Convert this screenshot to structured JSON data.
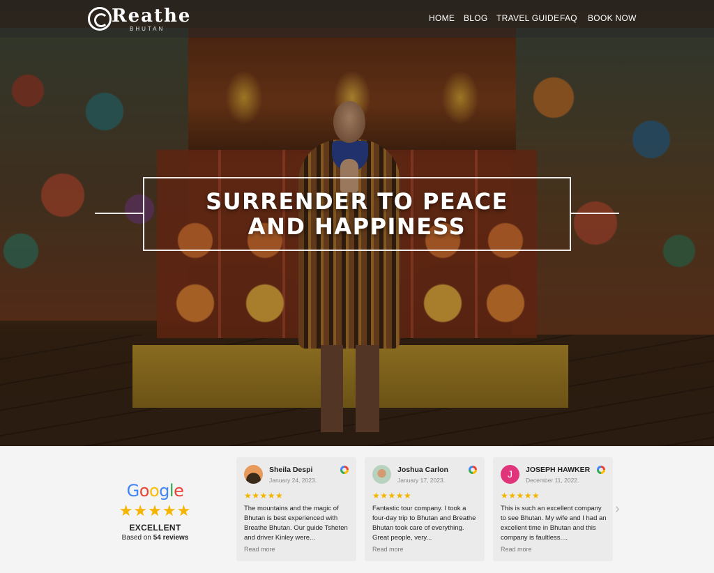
{
  "nav": {
    "logo": {
      "name": "Reathe",
      "sub": "BHUTAN"
    },
    "links": [
      "HOME",
      "BLOG",
      "TRAVEL GUIDE",
      "FAQ",
      "BOOK NOW"
    ]
  },
  "hero": {
    "headline": "SURRENDER TO PEACE AND HAPPINESS"
  },
  "reviews": {
    "summary": {
      "provider": "Google",
      "stars": "★★★★★",
      "rating_word": "EXCELLENT",
      "based_on_prefix": "Based on",
      "review_count": "54 reviews"
    },
    "cards": [
      {
        "name": "Sheila Despi",
        "date": "January 24, 2023.",
        "stars": "★★★★★",
        "text": "The mountains and the magic of Bhutan is best experienced with Breathe Bhutan. Our guide Tsheten and driver Kinley were...",
        "read_more": "Read more"
      },
      {
        "name": "Joshua Carlon",
        "date": "January 17, 2023.",
        "stars": "★★★★★",
        "text": "Fantastic tour company. I took a four-day trip to Bhutan and Breathe Bhutan took care of everything. Great people, very...",
        "read_more": "Read more"
      },
      {
        "name": "JOSEPH HAWKER",
        "initial": "J",
        "date": "December 11, 2022.",
        "stars": "★★★★★",
        "text": "This is such an excellent company to see Bhutan. My wife and I had an excellent time in Bhutan and this company is faultless....",
        "read_more": "Read more"
      }
    ],
    "next_arrow": "›"
  },
  "colors": {
    "star": "#f5b400",
    "card_bg": "#ebebeb",
    "section_bg": "#f4f4f4",
    "avatar_j": "#e0357a"
  }
}
